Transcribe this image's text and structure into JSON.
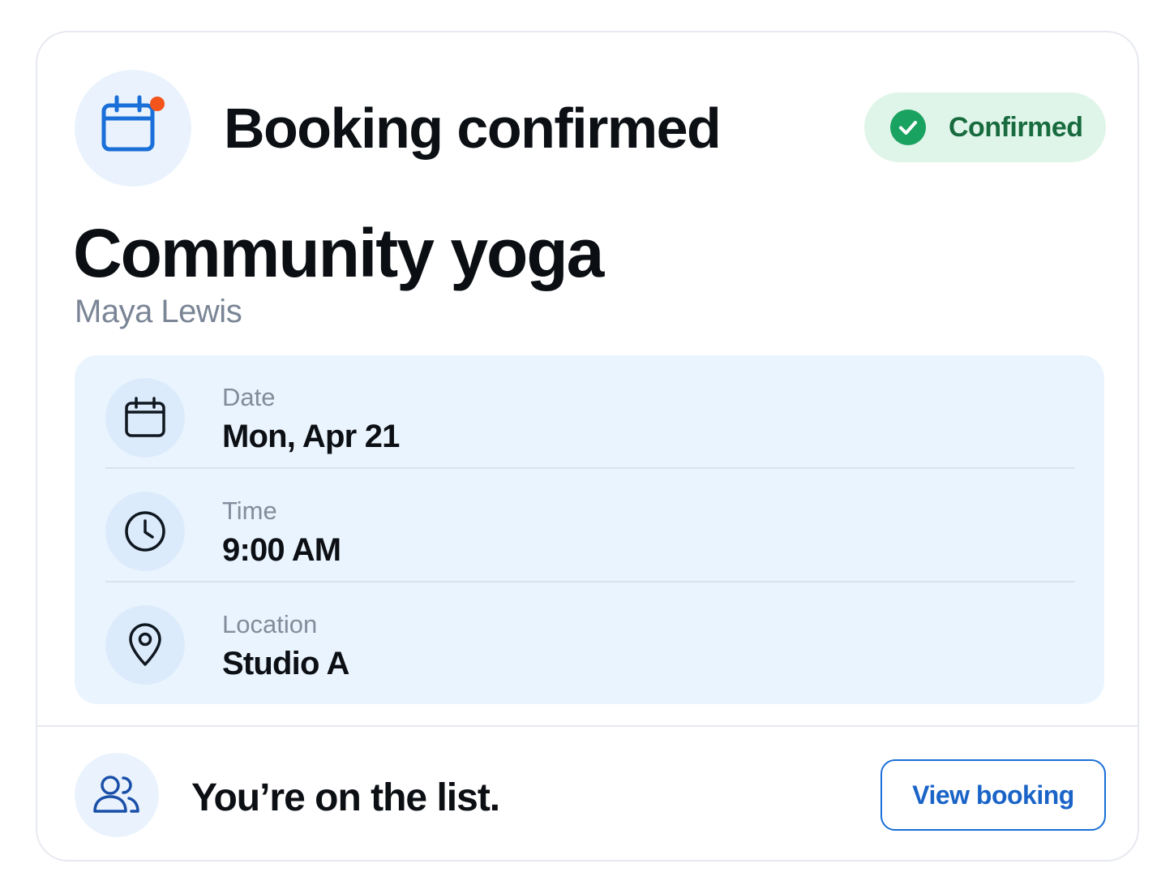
{
  "header": {
    "title": "Booking confirmed",
    "icon": "calendar-notification-icon",
    "status": {
      "label": "Confirmed",
      "icon": "check-circle-icon",
      "color": "#1aa260"
    }
  },
  "event": {
    "title": "Community yoga",
    "host": "Maya Lewis"
  },
  "details": [
    {
      "label": "Date",
      "value": "Mon, Apr 21",
      "icon": "calendar-icon"
    },
    {
      "label": "Time",
      "value": "9:00 AM",
      "icon": "clock-icon"
    },
    {
      "label": "Location",
      "value": "Studio A",
      "icon": "map-pin-icon"
    }
  ],
  "footer": {
    "message": "You’re on the list.",
    "icon": "users-icon",
    "button_label": "View booking"
  },
  "colors": {
    "accent": "#1a6fd8",
    "notification_dot": "#f2541b",
    "success": "#1aa260",
    "panel": "#eaf4fe"
  }
}
